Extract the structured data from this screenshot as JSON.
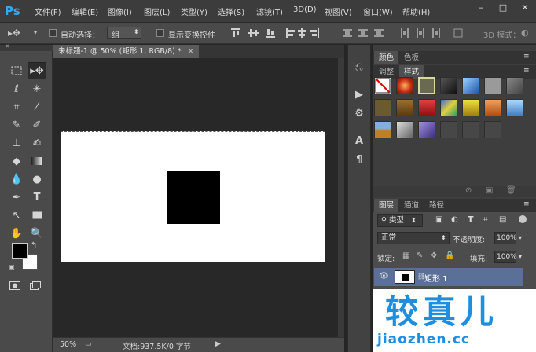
{
  "app": {
    "logo": "Ps"
  },
  "menu": [
    "文件(F)",
    "编辑(E)",
    "图像(I)",
    "图层(L)",
    "类型(Y)",
    "选择(S)",
    "滤镜(T)",
    "3D(D)",
    "视图(V)",
    "窗口(W)",
    "帮助(H)"
  ],
  "window_controls": {
    "minimize": "–",
    "restore": "□",
    "close": "✕"
  },
  "options": {
    "auto_select_label": "自动选择：",
    "auto_select_value": "组",
    "show_transform_label": "显示变换控件",
    "mode_3d_label": "3D 模式："
  },
  "document": {
    "tab_title": "未标题-1 @ 50% (矩形 1, RGB/8) *",
    "tab_close": "×",
    "zoom": "50%",
    "doc_info": "文档:937.5K/0 字节"
  },
  "panels": {
    "color_tabs": [
      "颜色",
      "色板"
    ],
    "style_tabs": [
      "调整",
      "样式"
    ],
    "layer_tabs": [
      "图层",
      "通道",
      "路径"
    ],
    "filter_kind": "类型",
    "blend_mode": "正常",
    "opacity_label": "不透明度:",
    "opacity_value": "100%",
    "lock_label": "锁定:",
    "fill_label": "填充:",
    "fill_value": "100%",
    "layer_name": "矩形 1"
  },
  "watermark": {
    "title": "较真儿",
    "url": "jiaozhen.cc"
  },
  "colors": {
    "foreground": "#000000",
    "background": "#ffffff",
    "accent": "#1e8fe0",
    "logo": "#31a8ff",
    "selected_layer": "#5a7096"
  },
  "style_swatches": [
    "#e8e8e8",
    "#d43a1a",
    "#5a5a3a",
    "#2a2a2a",
    "#3a7fd0",
    "#9a9a9a",
    "#6a6a6a",
    "#7a6a3a",
    "#8a6a2a",
    "#c02020",
    "#d0b040",
    "#e0c020",
    "#d08040",
    "#70a0d0",
    "#c08020",
    "#8a8a8a",
    "#6a5a9a",
    "#4a4a4a",
    "#4a4a4a",
    "#4a4a4a"
  ]
}
